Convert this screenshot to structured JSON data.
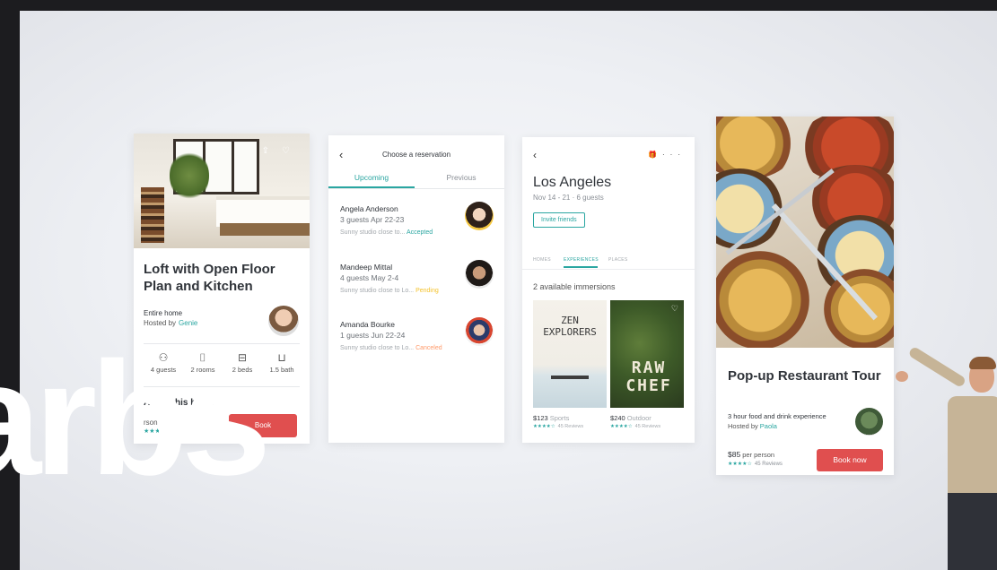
{
  "card1": {
    "title": "Loft with Open Floor Plan and Kitchen",
    "type": "Entire home",
    "hosted_by": "Hosted by",
    "host": "Genie",
    "amenities": [
      {
        "icon": "guests-icon",
        "label": "4 guests"
      },
      {
        "icon": "door-icon",
        "label": "2 rooms"
      },
      {
        "icon": "bed-icon",
        "label": "2 beds"
      },
      {
        "icon": "bath-icon",
        "label": "1.5 bath"
      }
    ],
    "about": "About this home",
    "price_fragment": "rson",
    "stars": "★★★★",
    "book": "Book"
  },
  "card2": {
    "title": "Choose a reservation",
    "tabs": [
      "Upcoming",
      "Previous"
    ],
    "reservations": [
      {
        "name": "Angela Anderson",
        "detail": "3 guests   Apr 22-23",
        "line": "Sunny studio close to...",
        "status": "Accepted"
      },
      {
        "name": "Mandeep Mittal",
        "detail": "4 guests   May 2-4",
        "line": "Sunny studio close to Lo...",
        "status": "Pending"
      },
      {
        "name": "Amanda Bourke",
        "detail": "1 guests   Jun 22-24",
        "line": "Sunny studio close to Lo...",
        "status": "Canceled"
      }
    ]
  },
  "card3": {
    "city": "Los Angeles",
    "dates": "Nov 14 - 21 · 6 guests",
    "invite": "Invite friends",
    "tabs": [
      "HOMES",
      "EXPERIENCES",
      "PLACES"
    ],
    "available": "2 available immersions",
    "experiences": [
      {
        "title_l1": "ZEN",
        "title_l2": "EXPLORERS",
        "price": "$123",
        "category": "Sports",
        "stars": "★★★★☆",
        "reviews": "45 Reviews"
      },
      {
        "title_l1": "RAW",
        "title_l2": "CHEF",
        "price": "$240",
        "category": "Outdoor",
        "stars": "★★★★☆",
        "reviews": "45 Reviews"
      }
    ]
  },
  "card4": {
    "title": "Pop-up Restaurant Tour",
    "desc": "3 hour food and drink experience",
    "hosted_by": "Hosted by",
    "host": "Paola",
    "price": "$85",
    "per": "per person",
    "stars": "★★★★☆",
    "reviews": "45 Reviews",
    "book": "Book now"
  },
  "big_word": "arbs",
  "colors": {
    "accent_teal": "#2aa6a1",
    "book_red": "#e04f4f"
  }
}
